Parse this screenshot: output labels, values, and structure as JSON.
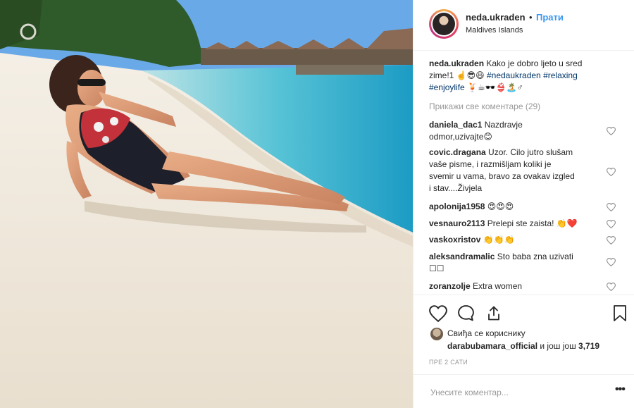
{
  "post": {
    "username": "neda.ukraden",
    "follow_dot": "•",
    "follow_label": "Прати",
    "location": "Maldives Islands"
  },
  "caption": {
    "username": "neda.ukraden",
    "text_line1": "Kako je dobro ljeto u sred",
    "text_line2": "zime!1 ☝️😎😃",
    "hashtag1": "#nedaukraden",
    "hashtag2": "#relaxing",
    "hashtag3": "#enjoylife",
    "emoji_tail": "🍹☕🕶️👙🏝️♂"
  },
  "view_all_comments": "Прикажи све коментаре (29)",
  "comments": [
    {
      "username": "daniela_dac1",
      "text_line1": "Nazdravje",
      "text_line2": "odmor,uzivajte😊"
    },
    {
      "username": "covic.dragana",
      "text_line1": "Uzor. Cilo jutro slušam",
      "text_line2": "vaše pisme, i razmišljam koliki je",
      "text_line3": "svemir u vama, bravo za ovakav izgled",
      "text_line4": "i stav....Živjela"
    },
    {
      "username": "apolonija1958",
      "text_line1": "😍😍😍"
    },
    {
      "username": "vesnauro2113",
      "text_line1": "Prelepi ste zaista! 👏❤️"
    },
    {
      "username": "vaskoxristov",
      "text_line1": "👏👏👏"
    },
    {
      "username": "aleksandramalic",
      "text_line1": "Sto baba zna uzivati",
      "text_line2": "☐☐"
    },
    {
      "username": "zoranzolje",
      "text_line1": "Extra women"
    }
  ],
  "likes": {
    "line1": "Свиђа се кориснику",
    "liker": "darabubamara_official",
    "and_more": "и још још",
    "count": "3,719"
  },
  "timestamp": "ПРЕ 2 САТИ",
  "add_comment": {
    "placeholder": "Унесите коментар..."
  },
  "more_options": "•••",
  "icons": {
    "like": "heart-icon",
    "comment": "comment-bubble-icon",
    "share": "share-arrow-icon",
    "save": "bookmark-icon"
  },
  "colors": {
    "accent": "#3897f0",
    "hashtag": "#003569",
    "muted": "#999999",
    "text": "#262626",
    "border": "#efefef"
  }
}
